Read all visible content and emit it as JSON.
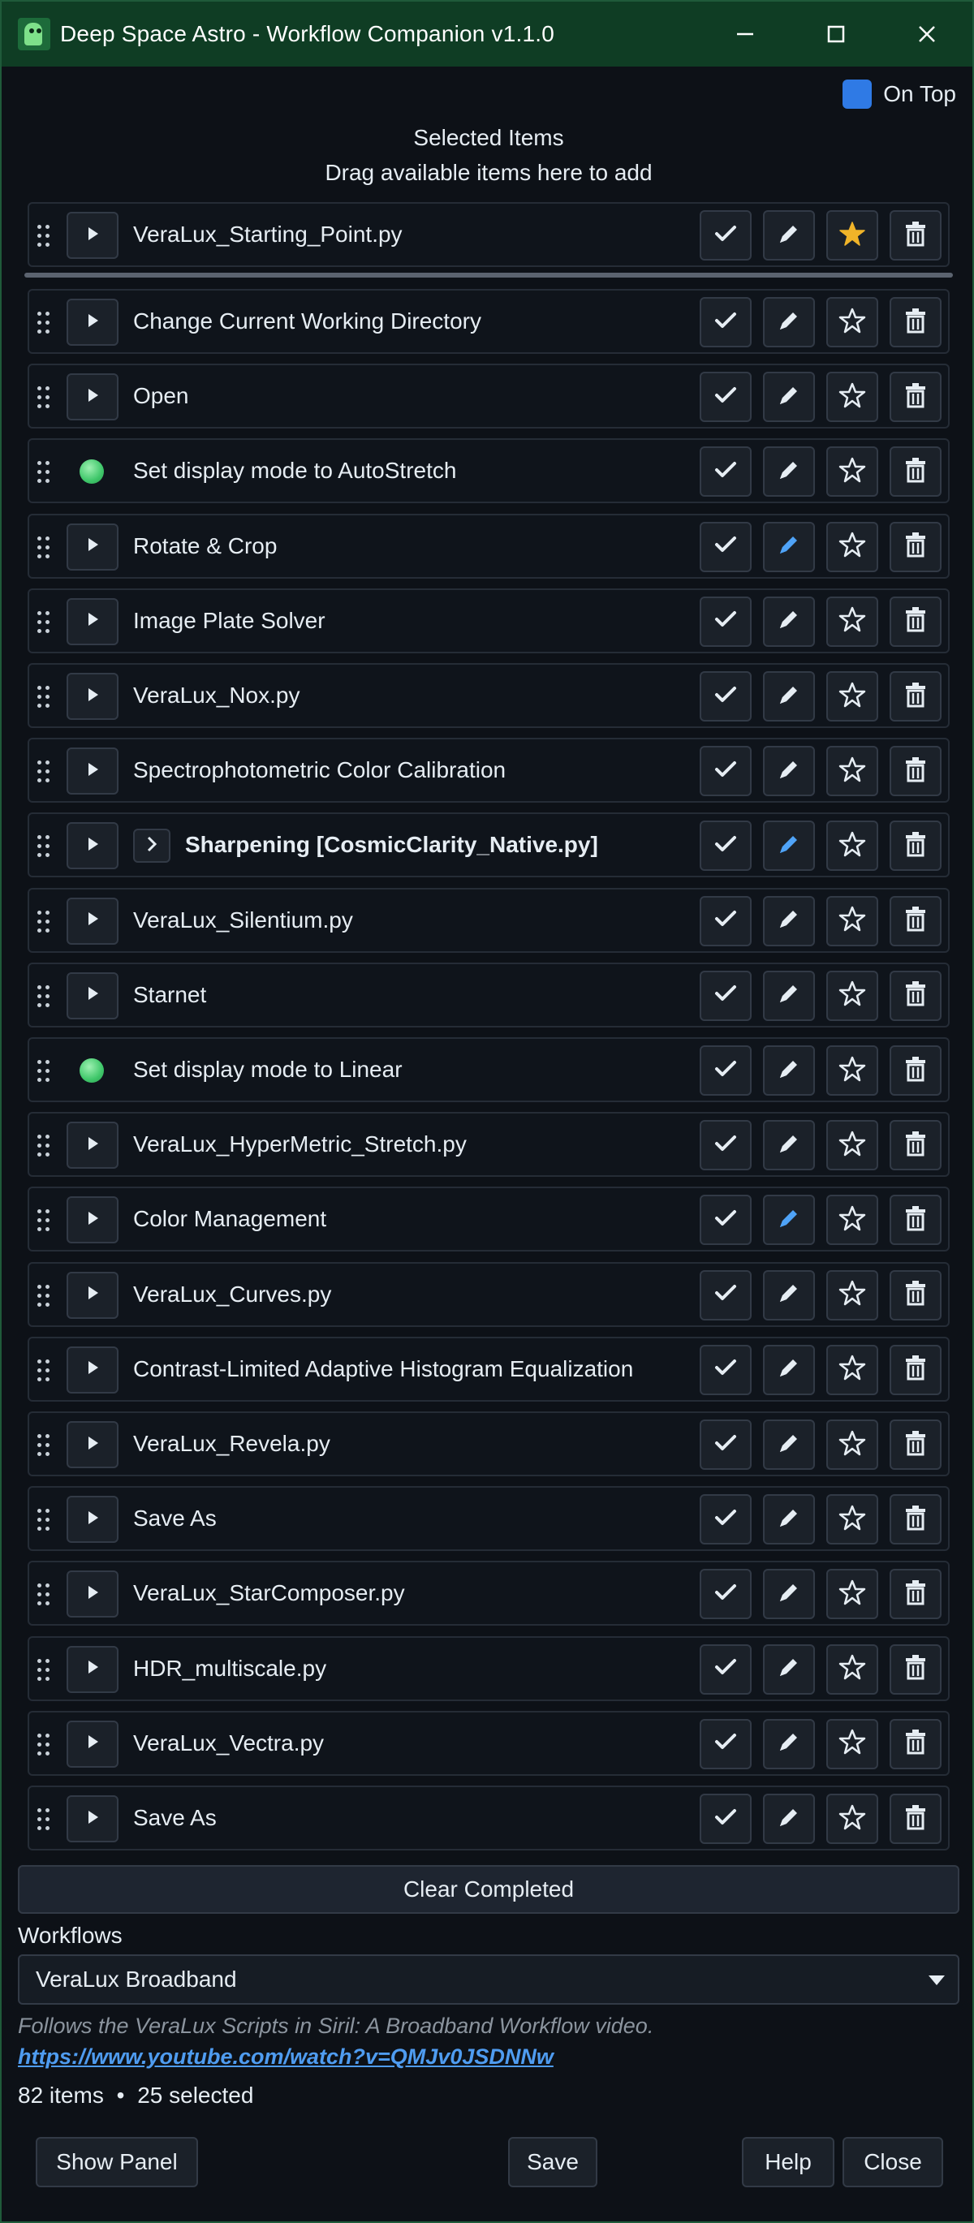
{
  "window": {
    "title": "Deep Space Astro - Workflow Companion  v1.1.0",
    "icon": "alien-app-icon",
    "controls": [
      "minimize-icon",
      "maximize-icon",
      "close-icon"
    ]
  },
  "on_top": {
    "label": "On Top",
    "checked": true,
    "color": "#2f7ae5"
  },
  "header": {
    "title": "Selected Items",
    "subtitle": "Drag available items here to add"
  },
  "pinned_item": {
    "label": "VeraLux_Starting_Point.py",
    "type": "play",
    "starred": true,
    "edit_active": false
  },
  "items": [
    {
      "label": "Change Current Working Directory",
      "type": "play",
      "starred": false,
      "edit_active": false
    },
    {
      "label": "Open",
      "type": "play",
      "starred": false,
      "edit_active": false
    },
    {
      "label": "Set display mode to AutoStretch",
      "type": "dot",
      "starred": false,
      "edit_active": false
    },
    {
      "label": "Rotate & Crop",
      "type": "play",
      "starred": false,
      "edit_active": true
    },
    {
      "label": "Image Plate Solver",
      "type": "play",
      "starred": false,
      "edit_active": false
    },
    {
      "label": "VeraLux_Nox.py",
      "type": "play",
      "starred": false,
      "edit_active": false
    },
    {
      "label": "Spectrophotometric Color Calibration",
      "type": "play",
      "starred": false,
      "edit_active": false
    },
    {
      "label": "Sharpening [CosmicClarity_Native.py]",
      "type": "group",
      "starred": false,
      "edit_active": true
    },
    {
      "label": "VeraLux_Silentium.py",
      "type": "play",
      "starred": false,
      "edit_active": false
    },
    {
      "label": "Starnet",
      "type": "play",
      "starred": false,
      "edit_active": false
    },
    {
      "label": "Set display mode to Linear",
      "type": "dot",
      "starred": false,
      "edit_active": false
    },
    {
      "label": "VeraLux_HyperMetric_Stretch.py",
      "type": "play",
      "starred": false,
      "edit_active": false
    },
    {
      "label": "Color Management",
      "type": "play",
      "starred": false,
      "edit_active": true
    },
    {
      "label": "VeraLux_Curves.py",
      "type": "play",
      "starred": false,
      "edit_active": false
    },
    {
      "label": "Contrast-Limited Adaptive Histogram Equalization",
      "type": "play",
      "starred": false,
      "edit_active": false
    },
    {
      "label": "VeraLux_Revela.py",
      "type": "play",
      "starred": false,
      "edit_active": false
    },
    {
      "label": "Save As",
      "type": "play",
      "starred": false,
      "edit_active": false
    },
    {
      "label": "VeraLux_StarComposer.py",
      "type": "play",
      "starred": false,
      "edit_active": false
    },
    {
      "label": "HDR_multiscale.py",
      "type": "play",
      "starred": false,
      "edit_active": false
    },
    {
      "label": "VeraLux_Vectra.py",
      "type": "play",
      "starred": false,
      "edit_active": false
    },
    {
      "label": "Save As",
      "type": "play",
      "starred": false,
      "edit_active": false
    }
  ],
  "clear_completed": "Clear Completed",
  "workflows": {
    "label": "Workflows",
    "selected": "VeraLux Broadband",
    "description": "Follows the VeraLux Scripts in Siril: A Broadband Workflow video. ",
    "link_text": "https://www.youtube.com/watch?v=QMJv0JSDNNw"
  },
  "summary": {
    "items": "82 items",
    "separator": "•",
    "selected": "25 selected"
  },
  "footer": {
    "show_panel": "Show Panel",
    "save": "Save",
    "help": "Help",
    "close": "Close"
  },
  "colors": {
    "titlebar": "#0f3d24",
    "accent_blue": "#2f7ae5",
    "star_gold": "#f0b429",
    "edit_active": "#4fa3f7",
    "status_green": "#3fc76a"
  }
}
